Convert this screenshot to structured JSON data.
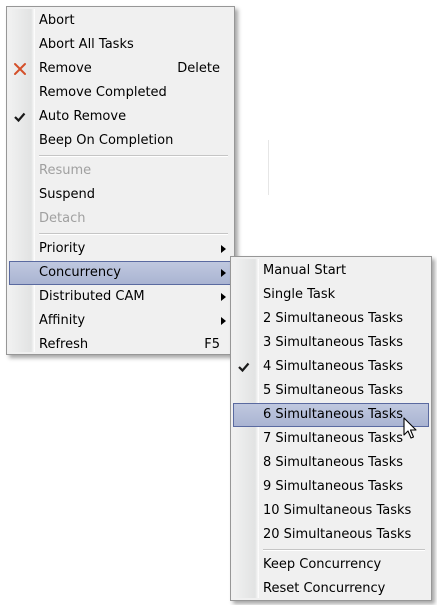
{
  "main_menu": {
    "items": [
      {
        "label": "Abort"
      },
      {
        "label": "Abort All Tasks"
      },
      {
        "label": "Remove",
        "shortcut": "Delete",
        "icon": "remove-x-icon"
      },
      {
        "label": "Remove Completed"
      },
      {
        "label": "Auto Remove",
        "checked": true,
        "icon": "checkmark-icon"
      },
      {
        "label": "Beep On Completion"
      },
      {
        "label": "Resume",
        "disabled": true
      },
      {
        "label": "Suspend"
      },
      {
        "label": "Detach",
        "disabled": true
      },
      {
        "label": "Priority",
        "submenu": true
      },
      {
        "label": "Concurrency",
        "submenu": true,
        "highlighted": true
      },
      {
        "label": "Distributed CAM",
        "submenu": true
      },
      {
        "label": "Affinity",
        "submenu": true
      },
      {
        "label": "Refresh",
        "shortcut": "F5"
      }
    ]
  },
  "concurrency_menu": {
    "items": [
      {
        "label": "Manual Start"
      },
      {
        "label": "Single Task"
      },
      {
        "label": "2 Simultaneous Tasks"
      },
      {
        "label": "3 Simultaneous Tasks"
      },
      {
        "label": "4 Simultaneous Tasks",
        "checked": true,
        "icon": "checkmark-icon"
      },
      {
        "label": "5 Simultaneous Tasks"
      },
      {
        "label": "6 Simultaneous Tasks",
        "highlighted": true
      },
      {
        "label": "7 Simultaneous Tasks"
      },
      {
        "label": "8 Simultaneous Tasks"
      },
      {
        "label": "9 Simultaneous Tasks"
      },
      {
        "label": "10 Simultaneous Tasks"
      },
      {
        "label": "20 Simultaneous Tasks"
      },
      {
        "label": "Keep Concurrency"
      },
      {
        "label": "Reset Concurrency"
      }
    ]
  },
  "colors": {
    "menu_bg": "#f0f0f0",
    "highlight": "#b4bcd8",
    "highlight_border": "#5a6aa0",
    "disabled_text": "#a0a0a0",
    "remove_icon": "#d4502a"
  }
}
